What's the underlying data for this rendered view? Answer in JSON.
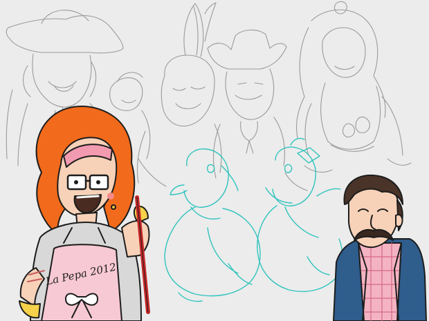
{
  "artwork": {
    "background": "#ececec",
    "sketch_color": "#9a9a9a",
    "cyan_color": "#2fc4bd",
    "orange_hair": "#f26a1b",
    "apron_pink": "#f7c9d4",
    "skin": "#f7d2b8",
    "jacket_blue": "#2f5d8c",
    "apron_text": "La Pepa 2012"
  }
}
